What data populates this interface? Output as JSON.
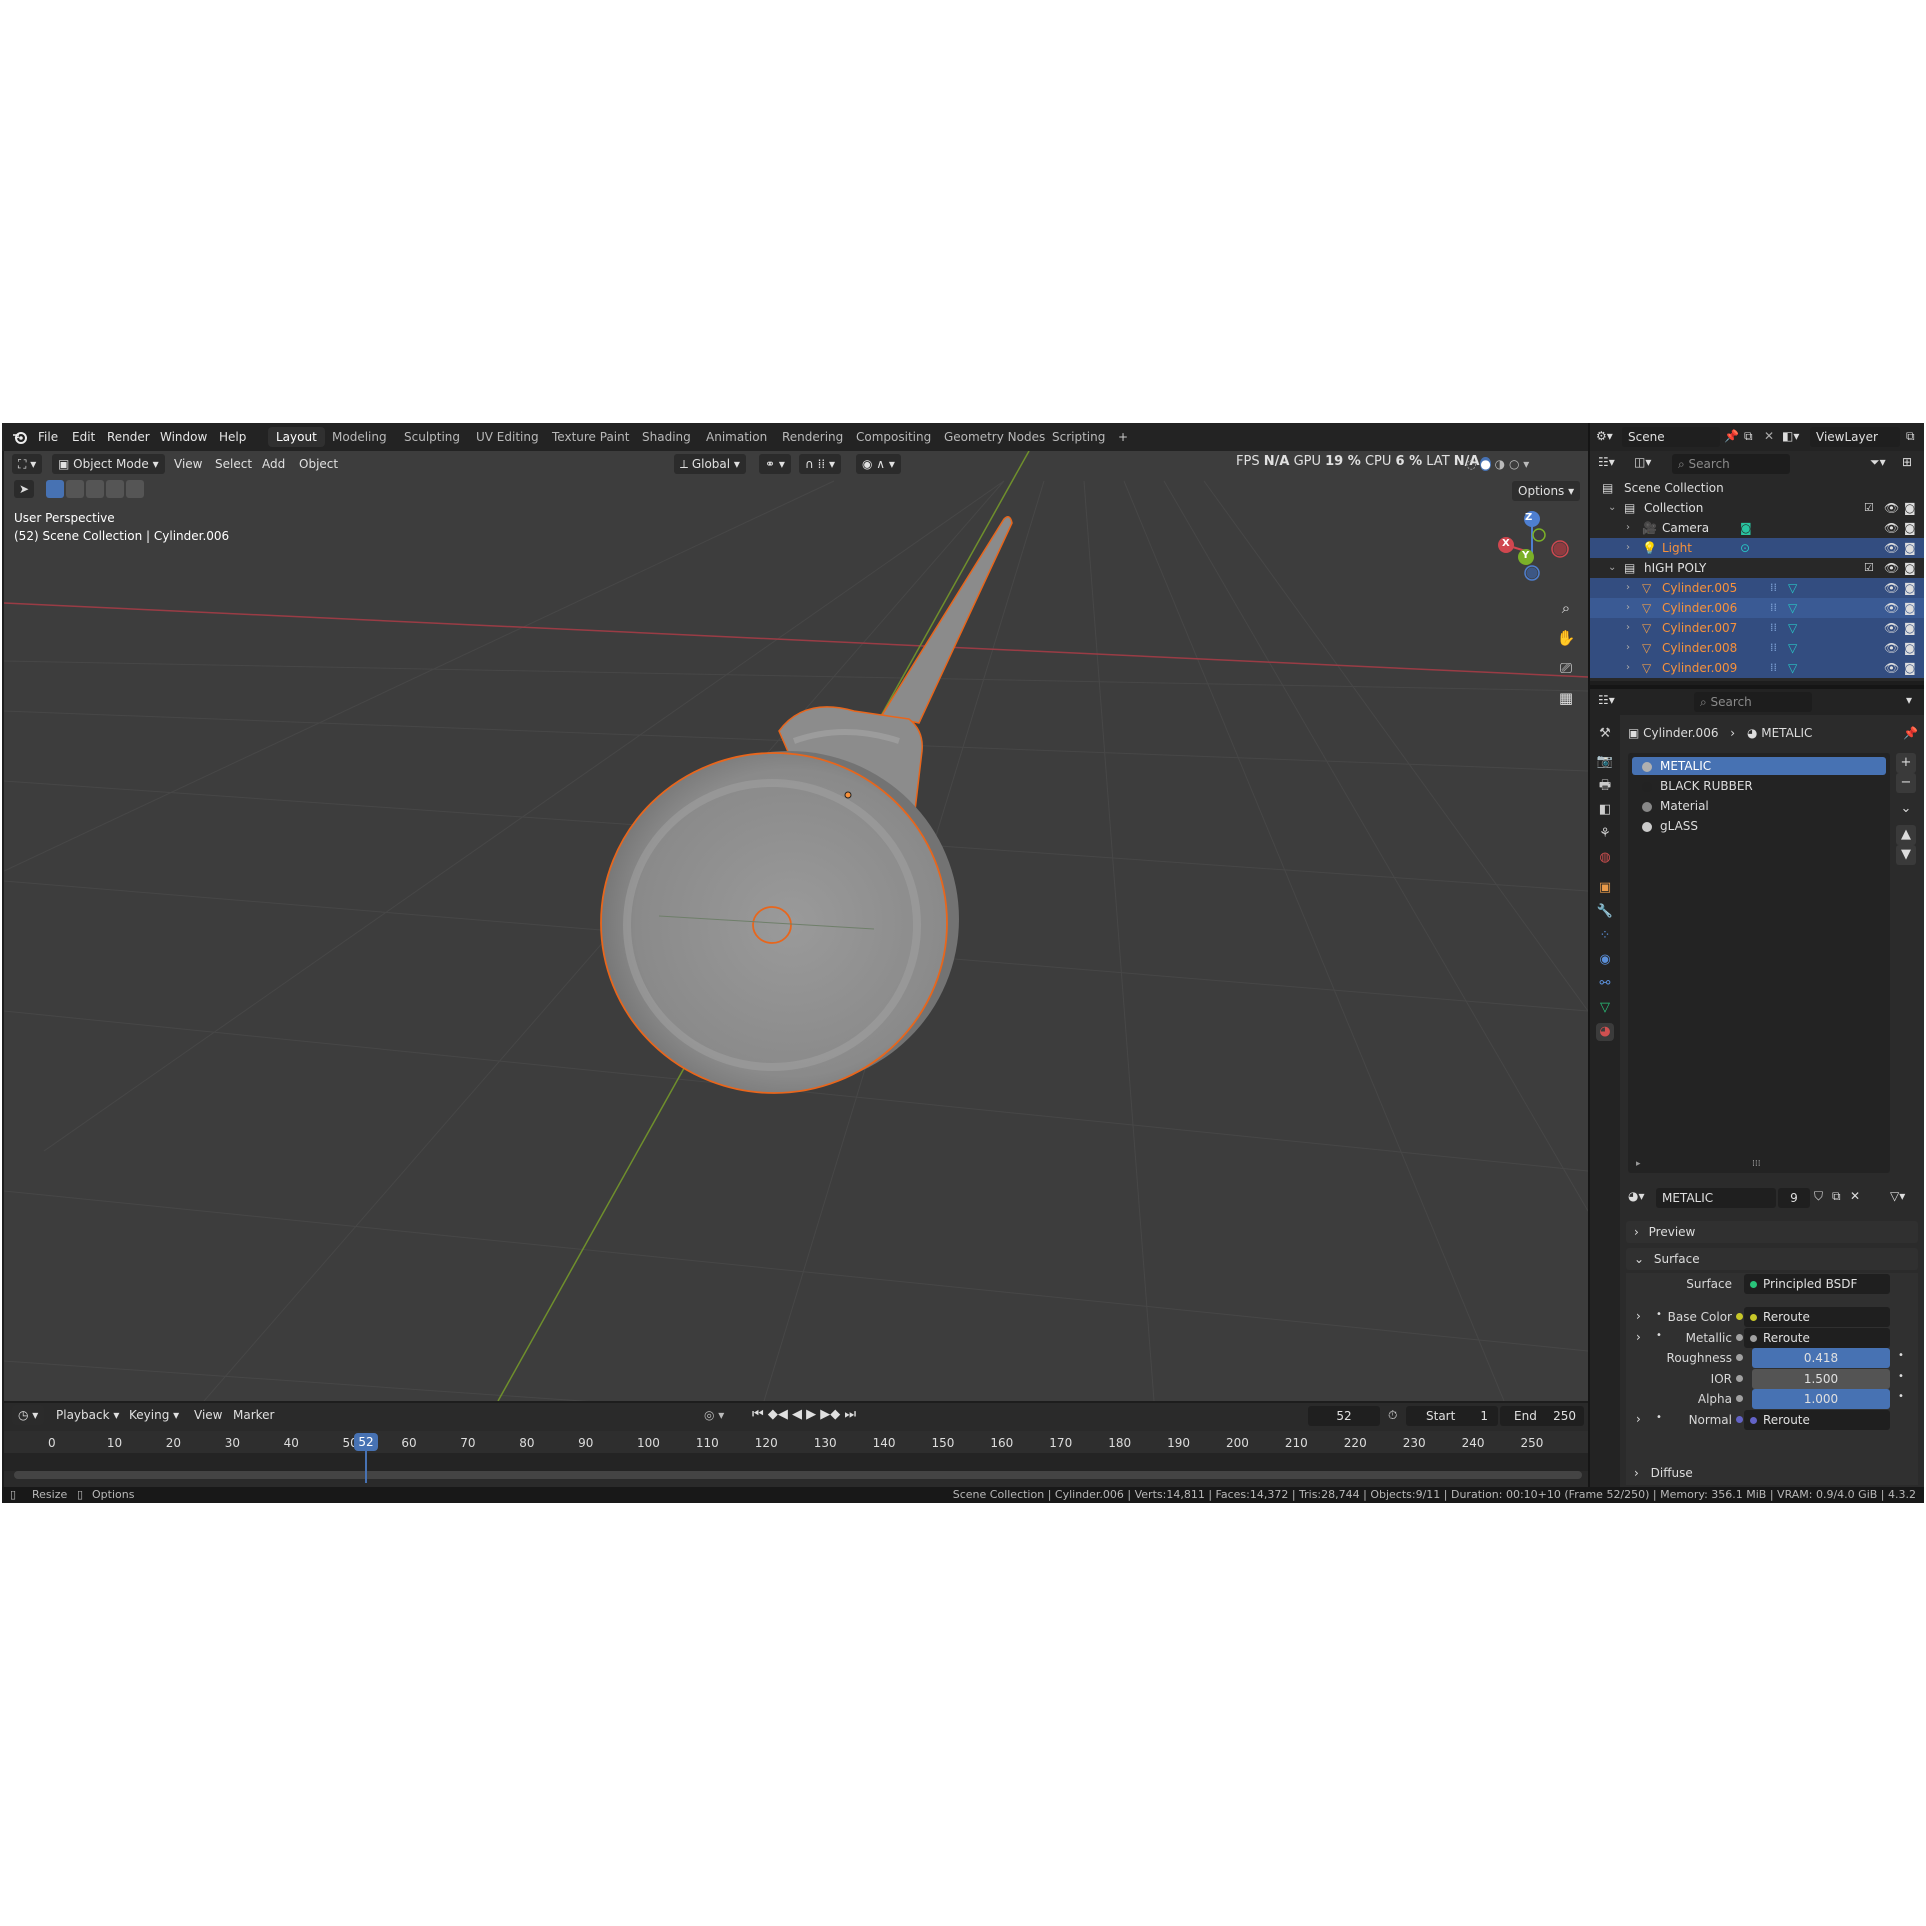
{
  "menu": [
    "File",
    "Edit",
    "Render",
    "Window",
    "Help"
  ],
  "workspaces": [
    "Layout",
    "Modeling",
    "Sculpting",
    "UV Editing",
    "Texture Paint",
    "Shading",
    "Animation",
    "Rendering",
    "Compositing",
    "Geometry Nodes",
    "Scripting"
  ],
  "workspace_add": "+",
  "viewport": {
    "mode": "Object Mode",
    "menus": [
      "View",
      "Select",
      "Add",
      "Object"
    ],
    "orientation": "Global",
    "options_label": "Options",
    "perspective": "User Perspective",
    "context": "(52) Scene Collection | Cylinder.006",
    "stats": {
      "fps_label": "FPS",
      "fps": "N/A",
      "gpu_label": "GPU",
      "gpu": "19 %",
      "cpu_label": "CPU",
      "cpu": "6 %",
      "lat_label": "LAT",
      "lat": "N/A"
    },
    "gizmo": {
      "z": "Z",
      "x": "X",
      "y": "Y"
    }
  },
  "timeline": {
    "menus": [
      "Playback",
      "Keying",
      "View",
      "Marker"
    ],
    "current_frame": "52",
    "start_label": "Start",
    "start": "1",
    "end_label": "End",
    "end": "250",
    "ticks": [
      "0",
      "10",
      "20",
      "30",
      "40",
      "50",
      "60",
      "70",
      "80",
      "90",
      "100",
      "110",
      "120",
      "130",
      "140",
      "150",
      "160",
      "170",
      "180",
      "190",
      "200",
      "210",
      "220",
      "230",
      "240",
      "250"
    ]
  },
  "status": {
    "left1": "Resize",
    "left2": "Options",
    "right": "Scene Collection | Cylinder.006 | Verts:14,811 | Faces:14,372 | Tris:28,744 | Objects:9/11 | Duration: 00:10+10 (Frame 52/250) | Memory: 356.1 MiB | VRAM: 0.9/4.0 GiB | 4.3.2"
  },
  "scene": {
    "scene_name": "Scene",
    "view_layer": "ViewLayer"
  },
  "outliner": {
    "search_placeholder": "Search",
    "root": "Scene Collection",
    "rows": [
      {
        "label": "Collection",
        "indent": 1,
        "type": "collection",
        "selected": false,
        "orange": false
      },
      {
        "label": "Camera",
        "indent": 2,
        "type": "camera",
        "selected": false,
        "orange": false
      },
      {
        "label": "Light",
        "indent": 2,
        "type": "light",
        "selected": true,
        "orange": true
      },
      {
        "label": "hIGH POLY",
        "indent": 1,
        "type": "collection",
        "selected": false,
        "orange": false
      },
      {
        "label": "Cylinder.005",
        "indent": 2,
        "type": "mesh",
        "selected": true,
        "orange": true
      },
      {
        "label": "Cylinder.006",
        "indent": 2,
        "type": "mesh",
        "selected": true,
        "orange": true,
        "active": true
      },
      {
        "label": "Cylinder.007",
        "indent": 2,
        "type": "mesh",
        "selected": true,
        "orange": true
      },
      {
        "label": "Cylinder.008",
        "indent": 2,
        "type": "mesh",
        "selected": true,
        "orange": true
      },
      {
        "label": "Cylinder.009",
        "indent": 2,
        "type": "mesh",
        "selected": true,
        "orange": true
      }
    ]
  },
  "properties": {
    "search_placeholder": "Search",
    "breadcrumb_object": "Cylinder.006",
    "breadcrumb_material": "METALIC",
    "slots": [
      "METALIC",
      "BLACK RUBBER",
      "Material",
      "gLASS"
    ],
    "material_name": "METALIC",
    "user_count": "9",
    "preview_label": "Preview",
    "surface_panel": "Surface",
    "surface_label": "Surface",
    "surface_value": "Principled BSDF",
    "inputs": [
      {
        "label": "Base Color",
        "value": "Reroute",
        "kind": "link",
        "socket": "#c7c729",
        "expand": true
      },
      {
        "label": "Metallic",
        "value": "Reroute",
        "kind": "link",
        "socket": "#a1a1a1",
        "expand": true
      },
      {
        "label": "Roughness",
        "value": "0.418",
        "kind": "slider",
        "fill": 0.0,
        "socket": "#a1a1a1",
        "expand": false
      },
      {
        "label": "IOR",
        "value": "1.500",
        "kind": "number",
        "socket": "#a1a1a1",
        "expand": false
      },
      {
        "label": "Alpha",
        "value": "1.000",
        "kind": "slider",
        "fill": 1.0,
        "socket": "#a1a1a1",
        "expand": false
      },
      {
        "label": "Normal",
        "value": "Reroute",
        "kind": "link",
        "socket": "#6363c7",
        "expand": true
      }
    ],
    "diffuse_label": "Diffuse"
  },
  "colors": {
    "accent": "#4772b3",
    "selected_orange": "#f7913b",
    "outline": "#e8661c",
    "mesh_icon": "#e89a4a"
  }
}
